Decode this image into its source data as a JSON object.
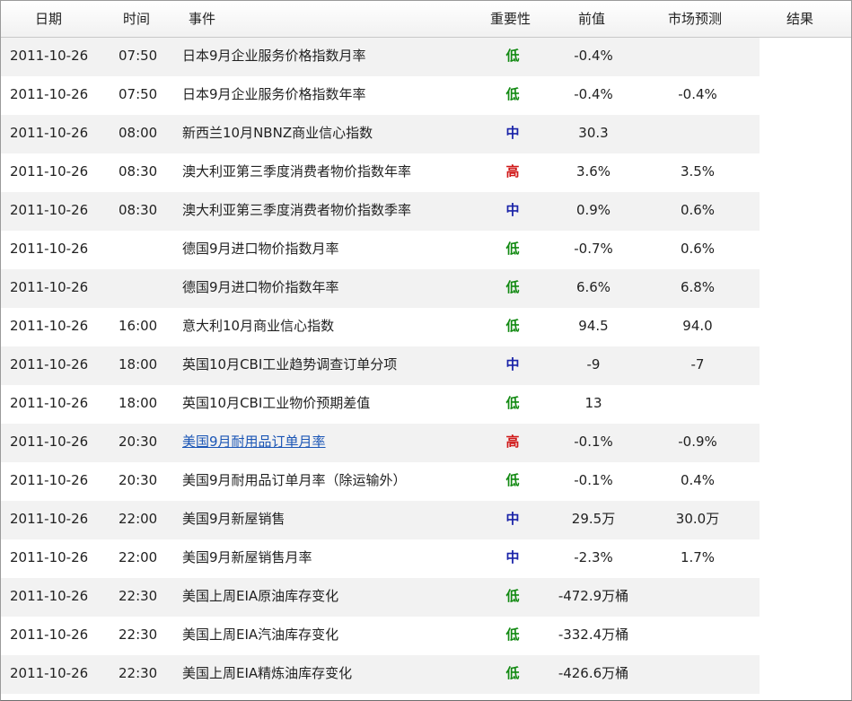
{
  "header": {
    "date": "日期",
    "time": "时间",
    "event": "事件",
    "importance": "重要性",
    "previous": "前值",
    "forecast": "市场预测",
    "result": "结果"
  },
  "rows": [
    {
      "date": "2011-10-26",
      "time": "07:50",
      "event": "日本9月企业服务价格指数月率",
      "importance": "低",
      "level": "low",
      "previous": "-0.4%",
      "forecast": "",
      "result": ""
    },
    {
      "date": "2011-10-26",
      "time": "07:50",
      "event": "日本9月企业服务价格指数年率",
      "importance": "低",
      "level": "low",
      "previous": "-0.4%",
      "forecast": "-0.4%",
      "result": ""
    },
    {
      "date": "2011-10-26",
      "time": "08:00",
      "event": "新西兰10月NBNZ商业信心指数",
      "importance": "中",
      "level": "mid",
      "previous": "30.3",
      "forecast": "",
      "result": ""
    },
    {
      "date": "2011-10-26",
      "time": "08:30",
      "event": "澳大利亚第三季度消费者物价指数年率",
      "importance": "高",
      "level": "high",
      "previous": "3.6%",
      "forecast": "3.5%",
      "result": ""
    },
    {
      "date": "2011-10-26",
      "time": "08:30",
      "event": "澳大利亚第三季度消费者物价指数季率",
      "importance": "中",
      "level": "mid",
      "previous": "0.9%",
      "forecast": "0.6%",
      "result": ""
    },
    {
      "date": "2011-10-26",
      "time": "",
      "event": "德国9月进口物价指数月率",
      "importance": "低",
      "level": "low",
      "previous": "-0.7%",
      "forecast": "0.6%",
      "result": ""
    },
    {
      "date": "2011-10-26",
      "time": "",
      "event": "德国9月进口物价指数年率",
      "importance": "低",
      "level": "low",
      "previous": "6.6%",
      "forecast": "6.8%",
      "result": ""
    },
    {
      "date": "2011-10-26",
      "time": "16:00",
      "event": "意大利10月商业信心指数",
      "importance": "低",
      "level": "low",
      "previous": "94.5",
      "forecast": "94.0",
      "result": ""
    },
    {
      "date": "2011-10-26",
      "time": "18:00",
      "event": "英国10月CBI工业趋势调查订单分项",
      "importance": "中",
      "level": "mid",
      "previous": "-9",
      "forecast": "-7",
      "result": ""
    },
    {
      "date": "2011-10-26",
      "time": "18:00",
      "event": "英国10月CBI工业物价预期差值",
      "importance": "低",
      "level": "low",
      "previous": "13",
      "forecast": "",
      "result": ""
    },
    {
      "date": "2011-10-26",
      "time": "20:30",
      "event": "美国9月耐用品订单月率",
      "importance": "高",
      "level": "high",
      "previous": "-0.1%",
      "forecast": "-0.9%",
      "result": "",
      "link": true
    },
    {
      "date": "2011-10-26",
      "time": "20:30",
      "event": "美国9月耐用品订单月率（除运输外）",
      "importance": "低",
      "level": "low",
      "previous": "-0.1%",
      "forecast": "0.4%",
      "result": ""
    },
    {
      "date": "2011-10-26",
      "time": "22:00",
      "event": "美国9月新屋销售",
      "importance": "中",
      "level": "mid",
      "previous": "29.5万",
      "forecast": "30.0万",
      "result": ""
    },
    {
      "date": "2011-10-26",
      "time": "22:00",
      "event": "美国9月新屋销售月率",
      "importance": "中",
      "level": "mid",
      "previous": "-2.3%",
      "forecast": "1.7%",
      "result": ""
    },
    {
      "date": "2011-10-26",
      "time": "22:30",
      "event": "美国上周EIA原油库存变化",
      "importance": "低",
      "level": "low",
      "previous": "-472.9万桶",
      "forecast": "",
      "result": ""
    },
    {
      "date": "2011-10-26",
      "time": "22:30",
      "event": "美国上周EIA汽油库存变化",
      "importance": "低",
      "level": "low",
      "previous": "-332.4万桶",
      "forecast": "",
      "result": ""
    },
    {
      "date": "2011-10-26",
      "time": "22:30",
      "event": "美国上周EIA精炼油库存变化",
      "importance": "低",
      "level": "low",
      "previous": "-426.6万桶",
      "forecast": "",
      "result": ""
    }
  ],
  "colors": {
    "low": "#138a13",
    "mid": "#1a23a8",
    "high": "#d01818",
    "stripe": "#f2f2f2",
    "link": "#1a55b5"
  }
}
